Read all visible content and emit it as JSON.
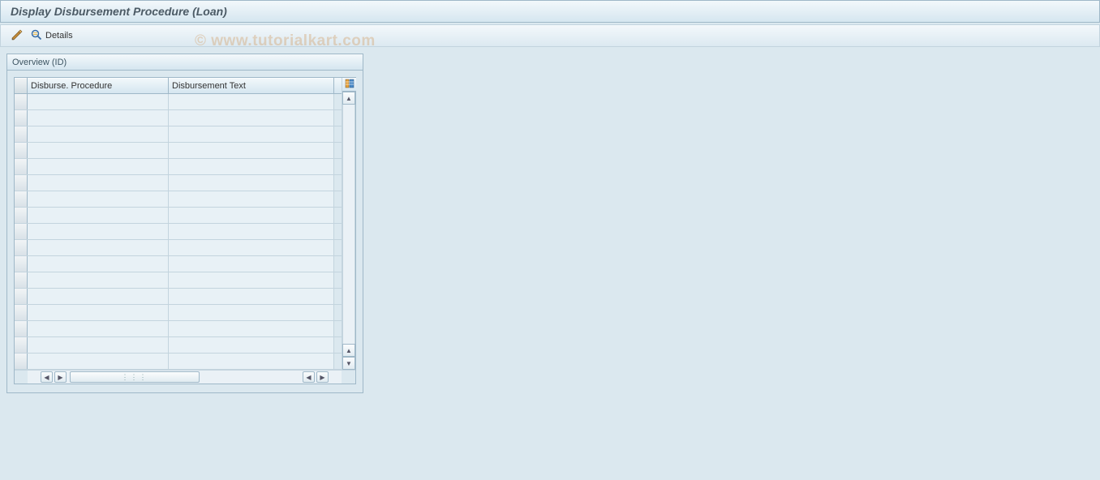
{
  "header": {
    "title": "Display Disbursement Procedure (Loan)"
  },
  "toolbar": {
    "edit_tooltip": "Toggle Change Mode",
    "details_label": "Details"
  },
  "watermark": "© www.tutorialkart.com",
  "panel": {
    "title": "Overview (ID)"
  },
  "table": {
    "columns": {
      "procedure": "Disburse. Procedure",
      "text": "Disbursement Text"
    },
    "rows": [
      {
        "procedure": "",
        "text": ""
      },
      {
        "procedure": "",
        "text": ""
      },
      {
        "procedure": "",
        "text": ""
      },
      {
        "procedure": "",
        "text": ""
      },
      {
        "procedure": "",
        "text": ""
      },
      {
        "procedure": "",
        "text": ""
      },
      {
        "procedure": "",
        "text": ""
      },
      {
        "procedure": "",
        "text": ""
      },
      {
        "procedure": "",
        "text": ""
      },
      {
        "procedure": "",
        "text": ""
      },
      {
        "procedure": "",
        "text": ""
      },
      {
        "procedure": "",
        "text": ""
      },
      {
        "procedure": "",
        "text": ""
      },
      {
        "procedure": "",
        "text": ""
      },
      {
        "procedure": "",
        "text": ""
      },
      {
        "procedure": "",
        "text": ""
      },
      {
        "procedure": "",
        "text": ""
      }
    ]
  }
}
